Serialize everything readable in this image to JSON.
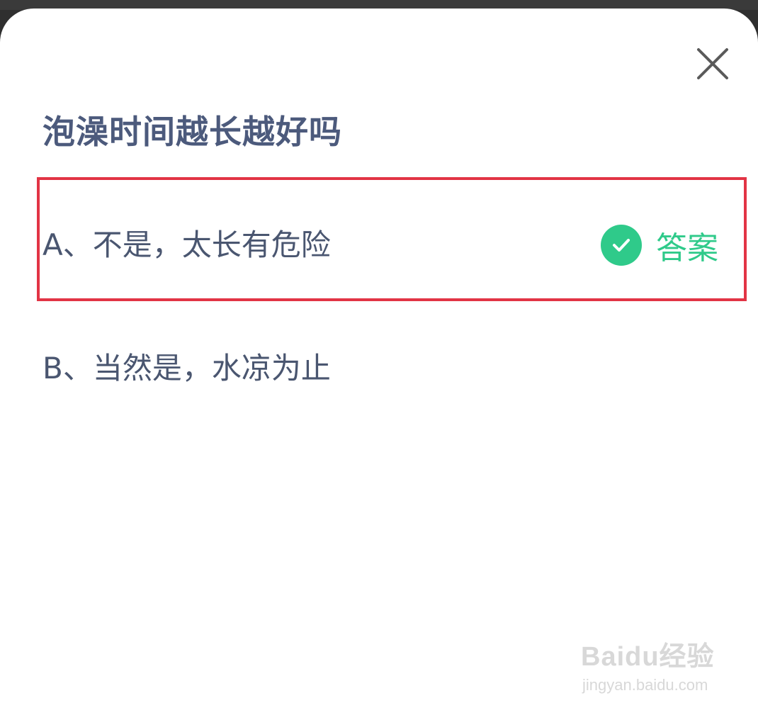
{
  "question": {
    "title": "泡澡时间越长越好吗"
  },
  "options": [
    {
      "label": "A、不是，太长有危险",
      "is_answer": true
    },
    {
      "label": "B、当然是，水凉为止",
      "is_answer": false
    }
  ],
  "answer_tag": {
    "label": "答案",
    "icon": "check-circle-icon"
  },
  "close": {
    "icon": "close-icon"
  },
  "watermark": {
    "brand": "Baidu经验",
    "url": "jingyan.baidu.com"
  },
  "colors": {
    "title": "#4c5a7c",
    "option_text": "#4a5670",
    "answer_green": "#2fca8a",
    "highlight_red": "#e23445"
  }
}
